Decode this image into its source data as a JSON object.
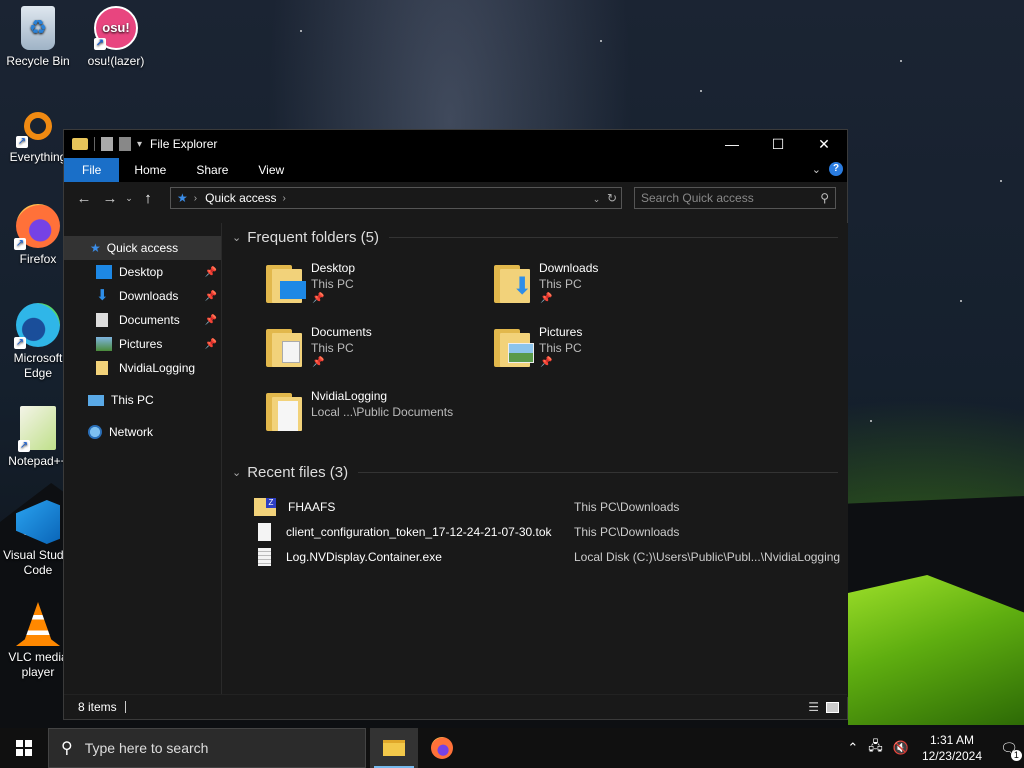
{
  "desktop": {
    "icons": [
      {
        "label": "Recycle Bin"
      },
      {
        "label": "osu!(lazer)",
        "badge": "osu!"
      },
      {
        "label": "Everything"
      },
      {
        "label": "Firefox"
      },
      {
        "label": "Microsoft Edge"
      },
      {
        "label": "Notepad++"
      },
      {
        "label": "Visual Studio Code"
      },
      {
        "label": "VLC media player"
      }
    ]
  },
  "window": {
    "title": "File Explorer",
    "controls": {
      "minimize": "—",
      "maximize": "☐",
      "close": "✕"
    },
    "ribbon": {
      "file": "File",
      "tabs": [
        "Home",
        "Share",
        "View"
      ],
      "help": "?"
    },
    "address": {
      "location": "Quick access",
      "refresh": "↻"
    },
    "search": {
      "placeholder": "Search Quick access"
    },
    "sidebar": {
      "quick_access": "Quick access",
      "items": [
        "Desktop",
        "Downloads",
        "Documents",
        "Pictures",
        "NvidiaLogging"
      ],
      "this_pc": "This PC",
      "network": "Network"
    },
    "frequent": {
      "header": "Frequent folders (5)",
      "folders": [
        {
          "name": "Desktop",
          "location": "This PC"
        },
        {
          "name": "Downloads",
          "location": "This PC"
        },
        {
          "name": "Documents",
          "location": "This PC"
        },
        {
          "name": "Pictures",
          "location": "This PC"
        },
        {
          "name": "NvidiaLogging",
          "location": "Local ...\\Public Documents"
        }
      ]
    },
    "recent": {
      "header": "Recent files (3)",
      "files": [
        {
          "name": "FHAAFS",
          "path": "This PC\\Downloads"
        },
        {
          "name": "client_configuration_token_17-12-24-21-07-30.tok",
          "path": "This PC\\Downloads"
        },
        {
          "name": "Log.NVDisplay.Container.exe",
          "path": "Local Disk (C:)\\Users\\Public\\Publ...\\NvidiaLogging"
        }
      ]
    },
    "status": {
      "items": "8 items"
    }
  },
  "taskbar": {
    "search_placeholder": "Type here to search",
    "time": "1:31 AM",
    "date": "12/23/2024",
    "notification_count": "1"
  },
  "colors": {
    "accent": "#1a6fc8",
    "folder": "#f2d27a",
    "tent": "#7cc61c"
  }
}
